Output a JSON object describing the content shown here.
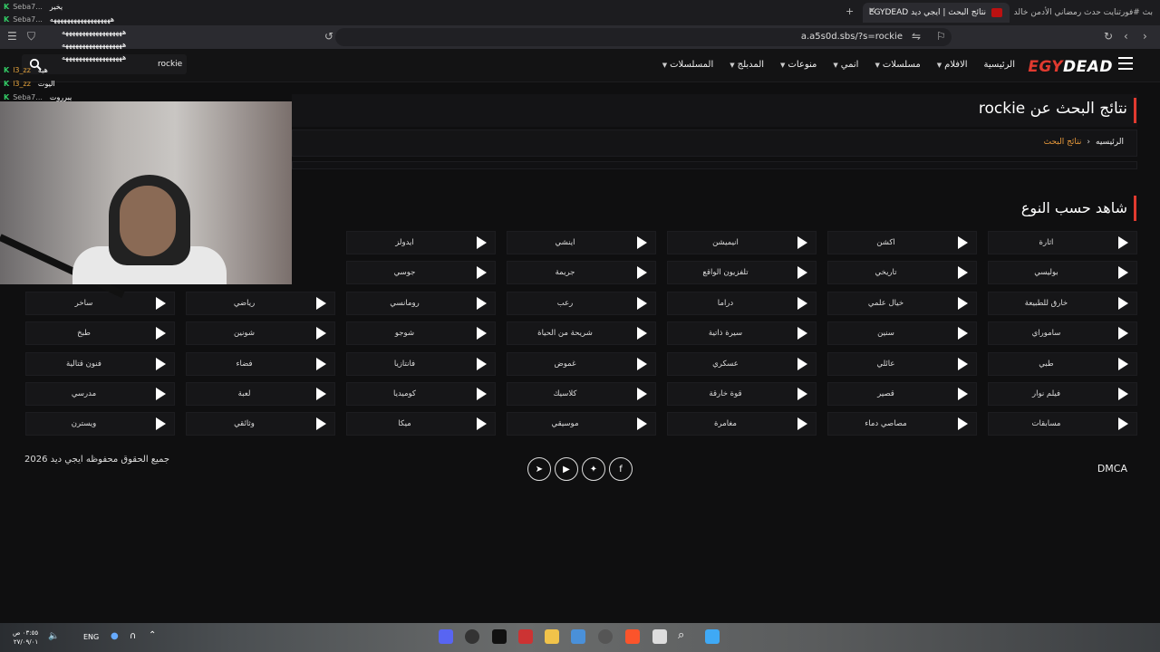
{
  "browser": {
    "active_tab": "نتائج البحث | ايجي ديد EGYDEAD",
    "other_tab": "بث #فورتنايت حدث رمضاني الأدمن خالد",
    "url": "a.a5s0d.sbs/?s=rockie"
  },
  "site": {
    "logo_part1": "EGY",
    "logo_part2": "DEAD",
    "nav": [
      {
        "label": "الرئيسية",
        "dropdown": false
      },
      {
        "label": "الافلام",
        "dropdown": true
      },
      {
        "label": "مسلسلات",
        "dropdown": true
      },
      {
        "label": "انمي",
        "dropdown": true
      },
      {
        "label": "منوعات",
        "dropdown": true
      },
      {
        "label": "المدبلج",
        "dropdown": true
      },
      {
        "label": "المسلسلات",
        "dropdown": true
      }
    ],
    "search_value": "rockie"
  },
  "results": {
    "title": "نتائج البحث عن rockie",
    "breadcrumb_home": "الرئيسيه",
    "breadcrumb_sep": "›",
    "breadcrumb_current": "نتائج البحث"
  },
  "genres": {
    "title": "شاهد حسب النوع",
    "rows": [
      [
        "اثارة",
        "اكشن",
        "انيميشن",
        "اينشي",
        "ايدولز",
        ""
      ],
      [
        "بوليسي",
        "تاريخي",
        "تلفزيون الواقع",
        "جريمة",
        "جوسي",
        ""
      ],
      [
        "خارق للطبيعة",
        "خيال علمي",
        "دراما",
        "رعب",
        "رومانسي",
        "رياضي",
        "ساخر"
      ],
      [
        "ساموراي",
        "سنين",
        "سيرة ذاتية",
        "شريحة من الحياة",
        "شوجو",
        "شونين",
        "طبخ"
      ],
      [
        "طبي",
        "عائلي",
        "عسكري",
        "غموض",
        "فانتازيا",
        "فضاء",
        "فنون قتالية"
      ],
      [
        "فيلم نوار",
        "قصير",
        "قوة خارقة",
        "كلاسيك",
        "كوميديا",
        "لعبة",
        "مدرسي"
      ],
      [
        "مسابقات",
        "مصاصي دماء",
        "مغامرة",
        "موسيقي",
        "ميكا",
        "وثائقي",
        "ويسترن"
      ]
    ]
  },
  "footer": {
    "copyright": "جميع الحقوق محفوظه ايجي ديد 2026",
    "dmca": "DMCA",
    "social": [
      "telegram-icon",
      "youtube-icon",
      "twitter-icon",
      "facebook-icon"
    ]
  },
  "overlay": {
    "chat": [
      {
        "user": "Seba7...",
        "msg": "يخير",
        "color": "#aaaaaa"
      },
      {
        "user": "Seba7...",
        "msg": "ههههههههههههههههههه",
        "color": "#aaaaaa"
      },
      {
        "user": "",
        "msg": "ههههههههههههههههههه",
        "color": "#aaaaaa"
      },
      {
        "user": "",
        "msg": "ههههههههههههههههههه",
        "color": "#aaaaaa"
      },
      {
        "user": "",
        "msg": "ههههههههههههههههههه",
        "color": "#aaaaaa"
      },
      {
        "user": "l3_zz",
        "msg": "هيه",
        "color": "#e6a43c"
      },
      {
        "user": "l3_zz",
        "msg": "اليوت",
        "color": "#e6a43c"
      },
      {
        "user": "Seba7...",
        "msg": "يبرروت",
        "color": "#aaaaaa"
      }
    ]
  },
  "taskbar": {
    "time": "٠٣:٥٥ ص",
    "date": "٢٧/٠٩/٠١",
    "lang": "ENG"
  }
}
